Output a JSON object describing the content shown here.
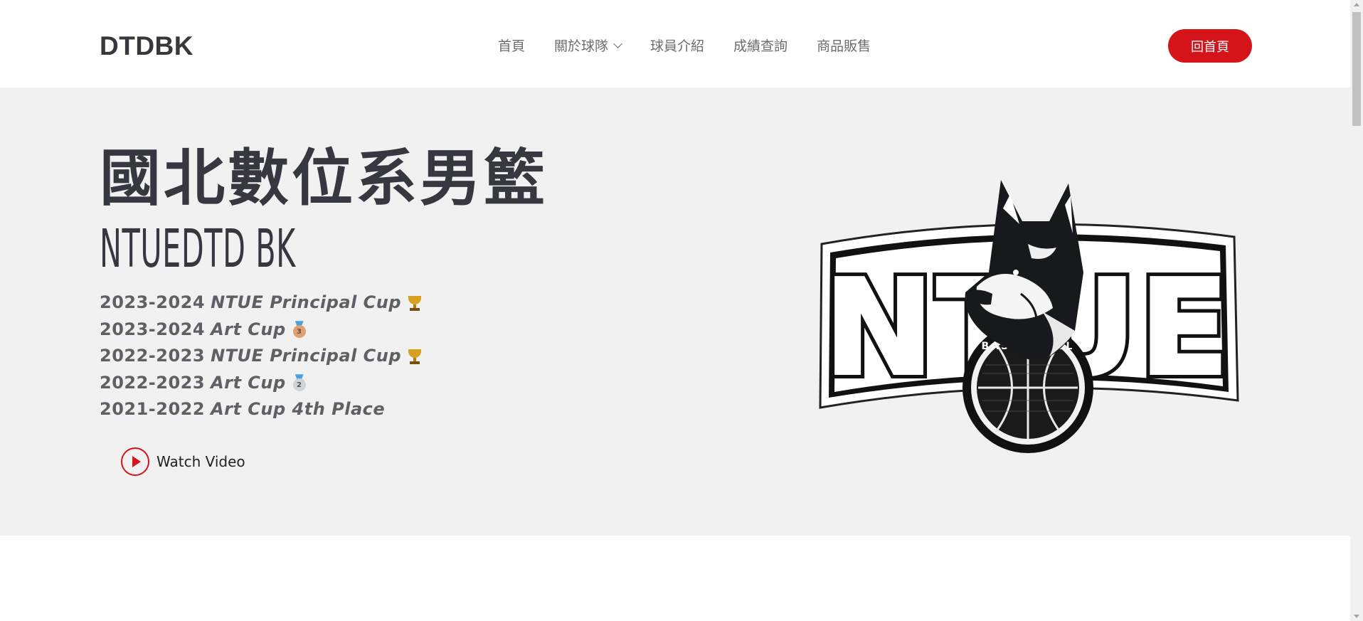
{
  "header": {
    "logo": "DTDBK",
    "nav": [
      {
        "label": "首頁"
      },
      {
        "label": "關於球隊",
        "dropdown": true
      },
      {
        "label": "球員介紹"
      },
      {
        "label": "成績查詢"
      },
      {
        "label": "商品販售"
      }
    ],
    "cta_label": "回首頁"
  },
  "hero": {
    "title_cn": "國北數位系男籃",
    "title_en": "NTUEDTD BK",
    "awards": [
      {
        "year": "2023-2024",
        "event": "NTUE Principal Cup",
        "icon": "trophy-icon"
      },
      {
        "year": "2023-2024",
        "event": "Art Cup",
        "icon": "bronze-medal-icon",
        "medal_number": "3"
      },
      {
        "year": "2022-2023",
        "event": "NTUE Principal Cup",
        "icon": "trophy-icon"
      },
      {
        "year": "2022-2023",
        "event": "Art Cup",
        "icon": "silver-medal-icon",
        "medal_number": "2"
      },
      {
        "year": "2021-2022",
        "event": "Art Cup 4th Place",
        "icon": null
      }
    ],
    "watch_label": "Watch Video",
    "emblem": {
      "text": "NTUE",
      "ball_text": "BASKETBALL"
    }
  },
  "colors": {
    "accent": "#d41419",
    "text_dark": "#37373f",
    "hero_bg": "#f1f1f1",
    "nav_text": "#6c6c74"
  }
}
